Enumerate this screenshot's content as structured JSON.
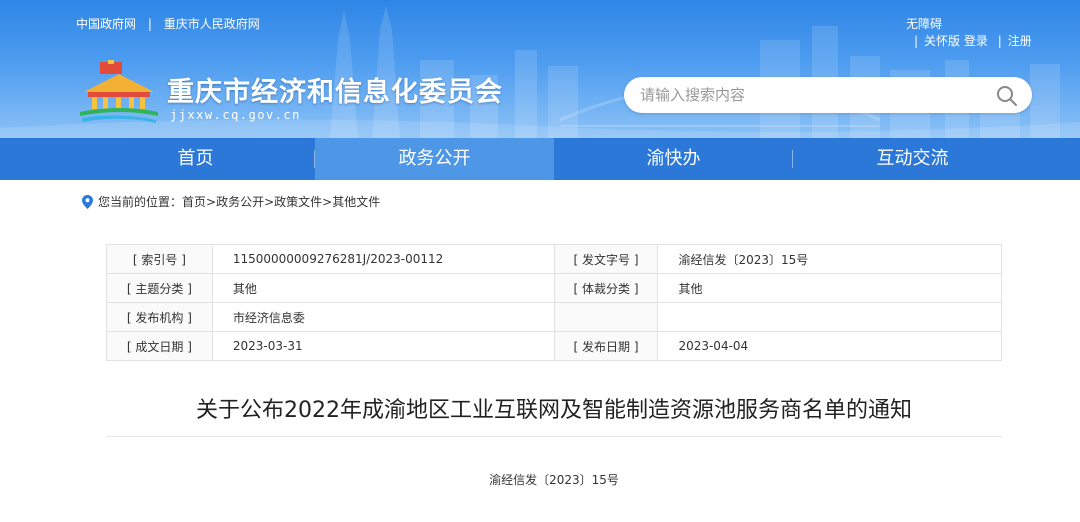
{
  "top_links": [
    "中国政府网",
    "重庆市人民政府网"
  ],
  "utility": {
    "accessibility": "无障碍",
    "care_mode": "关怀版",
    "login": "登录",
    "register": "注册"
  },
  "site": {
    "title": "重庆市经济和信息化委员会",
    "domain": "jjxxw.cq.gov.cn"
  },
  "search": {
    "placeholder": "请输入搜索内容"
  },
  "nav": {
    "items": [
      "首页",
      "政务公开",
      "渝快办",
      "互动交流"
    ],
    "active": "政务公开"
  },
  "breadcrumb": {
    "prefix": "您当前的位置：",
    "items": [
      "首页",
      ">政务公开",
      ">政策文件",
      ">其他文件"
    ]
  },
  "meta": {
    "rows": [
      [
        {
          "label": "[ 索引号 ]",
          "value": "11500000009276281J/2023-00112"
        },
        {
          "label": "[ 发文字号 ]",
          "value": "渝经信发〔2023〕15号"
        }
      ],
      [
        {
          "label": "[ 主题分类 ]",
          "value": "其他"
        },
        {
          "label": "[ 体裁分类 ]",
          "value": "其他"
        }
      ],
      [
        {
          "label": "[ 发布机构 ]",
          "value": "市经济信息委"
        },
        {
          "label": "",
          "value": ""
        }
      ],
      [
        {
          "label": "[ 成文日期 ]",
          "value": "2023-03-31"
        },
        {
          "label": "[ 发布日期 ]",
          "value": "2023-04-04"
        }
      ]
    ]
  },
  "article": {
    "title": "关于公布2022年成渝地区工业互联网及智能制造资源池服务商名单的通知",
    "doc_number": "渝经信发〔2023〕15号"
  },
  "colors": {
    "header_blue": "#2f86e6",
    "nav_blue": "#2b78d8",
    "nav_active": "#4e96e6"
  }
}
